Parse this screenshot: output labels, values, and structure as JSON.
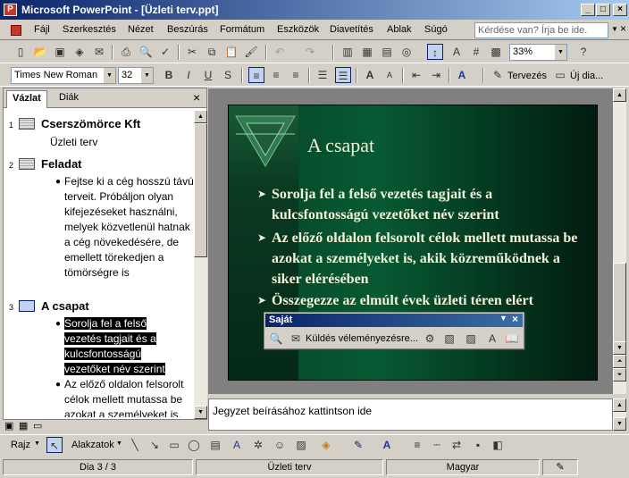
{
  "window": {
    "title": "Microsoft PowerPoint - [Üzleti terv.ppt]",
    "app_icon": "P",
    "minimize": "_",
    "maximize": "□",
    "close": "×"
  },
  "menu": {
    "items": [
      "Fájl",
      "Szerkesztés",
      "Nézet",
      "Beszúrás",
      "Formátum",
      "Eszközök",
      "Diavetítés",
      "Ablak",
      "Súgó"
    ],
    "help_placeholder": "Kérdése van? Írja be ide."
  },
  "standard_toolbar": {
    "zoom": "33%"
  },
  "format_toolbar": {
    "font": "Times New Roman",
    "size": "32",
    "design_label": "Tervezés",
    "new_slide_label": "Új dia..."
  },
  "left_pane": {
    "tabs": [
      "Vázlat",
      "Diák"
    ],
    "close": "×",
    "slides": [
      {
        "num": "1",
        "title": "Cserszömörce Kft",
        "body": [
          "Üzleti terv"
        ]
      },
      {
        "num": "2",
        "title": "Feladat",
        "body": [
          "Fejtse ki a cég hosszú távú terveit. Próbáljon olyan kifejezéseket használni, melyek közvetlenül hatnak a cég növekedésére, de emellett törekedjen a tömörségre is"
        ]
      },
      {
        "num": "3",
        "title": "A csapat",
        "body": [
          "Sorolja fel a felső vezetés tagjait és a kulcsfontosságú vezetőket név szerint",
          "Az előző oldalon felsorolt célok mellett mutassa be azokat a személyeket is,"
        ]
      }
    ]
  },
  "slide": {
    "title": "A csapat",
    "bullets": [
      "Sorolja fel a felső vezetés tagjait és a kulcsfontosságú vezetőket név szerint",
      "Az előző oldalon felsorolt célok mellett mutassa be azokat a személyeket is, akik közreműködnek a siker elérésében",
      "Összegezze az elmúlt évek üzleti téren elért"
    ]
  },
  "notes": {
    "placeholder": "Jegyzet beírásához kattintson ide"
  },
  "floating_toolbar": {
    "title": "Saját",
    "send_label": "Küldés véleményezésre..."
  },
  "drawing_toolbar": {
    "draw_label": "Rajz",
    "autoshapes_label": "Alakzatok"
  },
  "status": {
    "slide": "Dia 3 / 3",
    "design": "Üzleti terv",
    "language": "Magyar"
  }
}
